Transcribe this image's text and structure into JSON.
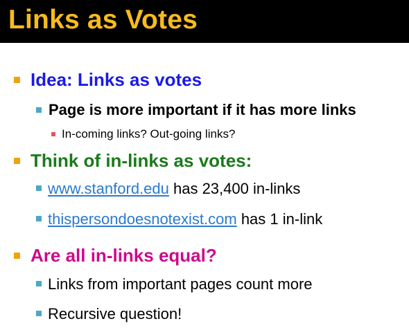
{
  "slide": {
    "title": "Links as Votes",
    "colors": {
      "title_bar": "#000000",
      "title_text": "#f7bb1e",
      "bullet_level1": "#f0a30a",
      "bullet_level2": "#4da7c8",
      "bullet_level3": "#e0555c",
      "heading1": "#1a1ae6",
      "heading2": "#1a7a1a",
      "heading3": "#cc0a8c",
      "link": "#2a7ad0"
    },
    "sections": [
      {
        "heading": "Idea: Links as votes",
        "sub": [
          {
            "text": "Page is more important if it has more links",
            "subsub": [
              "In-coming links? Out-going links?"
            ]
          }
        ]
      },
      {
        "heading": "Think of in-links as votes:",
        "sub": [
          {
            "link": "www.stanford.edu",
            "text": " has 23,400 in-links"
          },
          {
            "link": "thispersondoesnotexist.com",
            "text": " has 1 in-link"
          }
        ]
      },
      {
        "heading": "Are all in-links equal?",
        "sub": [
          {
            "text": "Links from important pages count more"
          },
          {
            "text": "Recursive question!"
          }
        ]
      }
    ]
  }
}
